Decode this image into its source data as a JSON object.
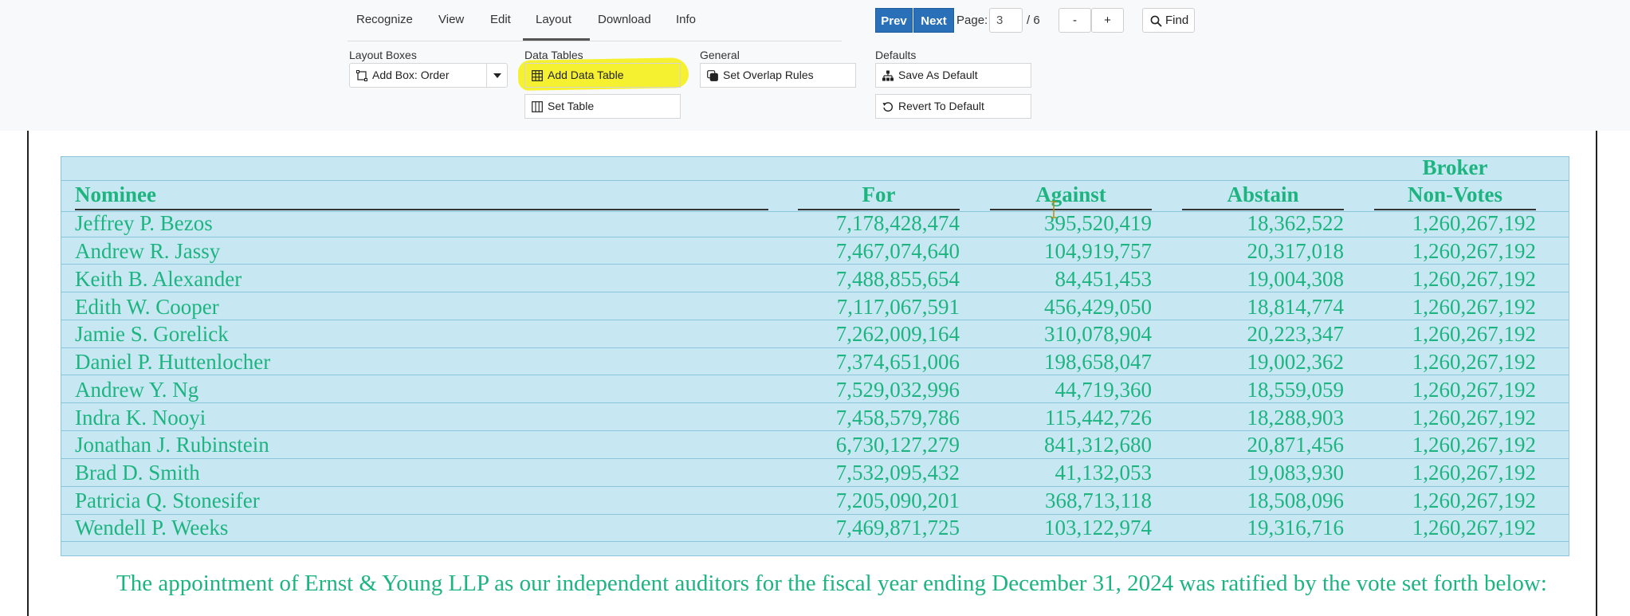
{
  "menu": {
    "tabs": [
      "Recognize",
      "View",
      "Edit",
      "Layout",
      "Download",
      "Info"
    ],
    "active": "Layout"
  },
  "pager": {
    "prev_label": "Prev",
    "next_label": "Next",
    "page_label": "Page:",
    "current_page": "3",
    "total_label": "/ 6",
    "zoom_out_label": "-",
    "zoom_in_label": "+",
    "find_label": "Find"
  },
  "groups": {
    "layout_boxes": {
      "label": "Layout Boxes",
      "add_box_label": "Add Box: Order"
    },
    "data_tables": {
      "label": "Data Tables",
      "add_table_label": "Add Data Table",
      "set_table_label": "Set Table"
    },
    "general": {
      "label": "General",
      "overlap_label": "Set Overlap Rules"
    },
    "defaults": {
      "label": "Defaults",
      "save_label": "Save As Default",
      "revert_label": "Revert To Default"
    }
  },
  "icons": {
    "add_box": "bounding-box-icon",
    "dropdown": "caret-down-icon",
    "add_table": "table-icon",
    "set_table": "columns-icon",
    "overlap": "layers-icon",
    "save": "sitemap-icon",
    "revert": "rotate-ccw-icon",
    "find": "search-icon"
  },
  "colors": {
    "primary_button": "#2a70b8",
    "highlight": "#f4f01a",
    "table_overlay": "#c7e8f3",
    "document_text": "#1db480"
  },
  "table": {
    "headers": {
      "nominee": "Nominee",
      "for": "For",
      "against": "Against",
      "abstain": "Abstain",
      "broker_line1": "Broker",
      "broker_line2": "Non-Votes"
    },
    "rows": [
      {
        "nominee": "Jeffrey P. Bezos",
        "for": "7,178,428,474",
        "against": "395,520,419",
        "abstain": "18,362,522",
        "broker": "1,260,267,192"
      },
      {
        "nominee": "Andrew R. Jassy",
        "for": "7,467,074,640",
        "against": "104,919,757",
        "abstain": "20,317,018",
        "broker": "1,260,267,192"
      },
      {
        "nominee": "Keith B. Alexander",
        "for": "7,488,855,654",
        "against": "84,451,453",
        "abstain": "19,004,308",
        "broker": "1,260,267,192"
      },
      {
        "nominee": "Edith W. Cooper",
        "for": "7,117,067,591",
        "against": "456,429,050",
        "abstain": "18,814,774",
        "broker": "1,260,267,192"
      },
      {
        "nominee": "Jamie S. Gorelick",
        "for": "7,262,009,164",
        "against": "310,078,904",
        "abstain": "20,223,347",
        "broker": "1,260,267,192"
      },
      {
        "nominee": "Daniel P. Huttenlocher",
        "for": "7,374,651,006",
        "against": "198,658,047",
        "abstain": "19,002,362",
        "broker": "1,260,267,192"
      },
      {
        "nominee": "Andrew Y. Ng",
        "for": "7,529,032,996",
        "against": "44,719,360",
        "abstain": "18,559,059",
        "broker": "1,260,267,192"
      },
      {
        "nominee": "Indra K. Nooyi",
        "for": "7,458,579,786",
        "against": "115,442,726",
        "abstain": "18,288,903",
        "broker": "1,260,267,192"
      },
      {
        "nominee": "Jonathan J. Rubinstein",
        "for": "6,730,127,279",
        "against": "841,312,680",
        "abstain": "20,871,456",
        "broker": "1,260,267,192"
      },
      {
        "nominee": "Brad D. Smith",
        "for": "7,532,095,432",
        "against": "41,132,053",
        "abstain": "19,083,930",
        "broker": "1,260,267,192"
      },
      {
        "nominee": "Patricia Q. Stonesifer",
        "for": "7,205,090,201",
        "against": "368,713,118",
        "abstain": "18,508,096",
        "broker": "1,260,267,192"
      },
      {
        "nominee": "Wendell P. Weeks",
        "for": "7,469,871,725",
        "against": "103,122,974",
        "abstain": "19,316,716",
        "broker": "1,260,267,192"
      }
    ]
  },
  "footer_text": "The appointment of Ernst & Young LLP as our independent auditors for the fiscal year ending December 31, 2024 was ratified by the vote set forth below:"
}
